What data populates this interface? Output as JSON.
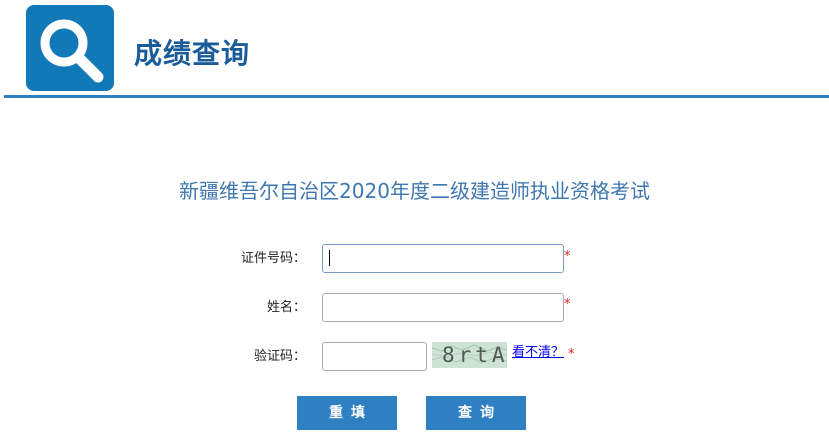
{
  "header": {
    "title": "成绩查询",
    "logo_icon": "magnifier-icon",
    "accent_color": "#1279b8"
  },
  "exam": {
    "title": "新疆维吾尔自治区2020年度二级建造师执业资格考试"
  },
  "form": {
    "id_label": "证件号码：",
    "id_value": "",
    "name_label": "姓名：",
    "name_value": "",
    "captcha_label": "验证码：",
    "captcha_value": "",
    "captcha_image_text": "8rtA",
    "refresh_link": "看不清？",
    "required_mark": "*"
  },
  "buttons": {
    "reset": "重填",
    "query": "查询"
  }
}
